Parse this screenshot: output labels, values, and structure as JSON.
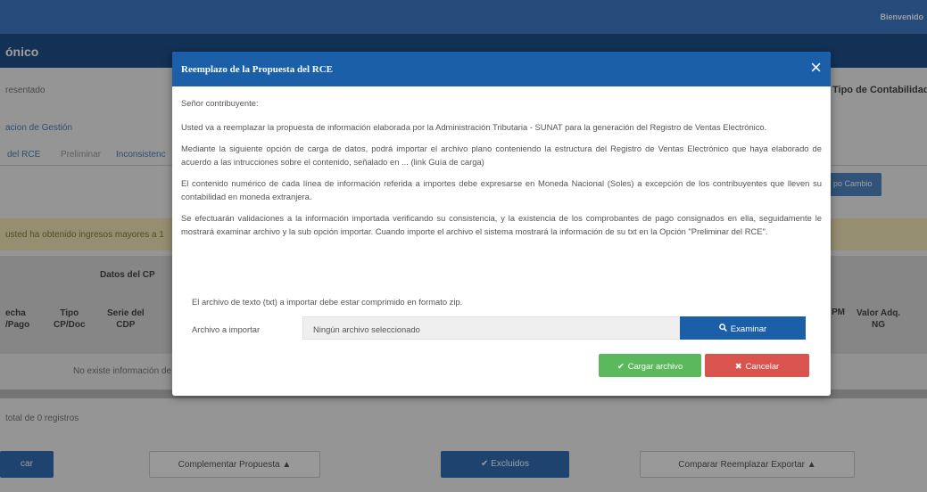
{
  "topbar": {
    "welcome": "Bienvenido"
  },
  "header": {
    "title": "ónico"
  },
  "background": {
    "presentado": "resentado",
    "tipo_contabilidad": "Tipo de Contabilidad:",
    "gestion_link": "acion de Gestión",
    "tabs": [
      "del RCE",
      "Preliminar",
      "Inconsistenc"
    ],
    "tipo_cambio_btn": "po Cambio",
    "alert": "usted ha obtenido ingresos mayores a 1",
    "datos_cp": "Datos del CP",
    "col_fecha": "echa\n/Pago",
    "col_tipo": "Tipo\nCP/Doc",
    "col_serie": "Serie del\nCDP",
    "col_pm": "PM",
    "col_valor": "Valor Adq.\nNG",
    "no_info": "No existe información de C",
    "total": "total de 0 registros",
    "bottom_buttons": {
      "first": "car",
      "complementar": "Complementar Propuesta",
      "excluidos": "Excluidos",
      "comparar": "Comparar Reemplazar Exportar"
    }
  },
  "modal": {
    "title": "Reemplazo de la Propuesta del RCE",
    "close": "×",
    "greeting": "Señor contribuyente:",
    "para1": "Usted va a reemplazar la propuesta de información elaborada por la Administración Tributaria - SUNAT para la generación del Registro de Ventas Electrónico.",
    "para2": "Mediante la siguiente opción de carga de datos, podrá importar el archivo plano conteniendo la estructura del Registro de Ventas Electrónico que haya elaborado de acuerdo a las intrucciones sobre el contenido, señalado en ... (link Guía de carga)",
    "para3": "El contenido numérico de cada línea de información referida a importes debe expresarse en Moneda Nacional (Soles) a excepción de los contribuyentes que lleven su contabilidad en moneda extranjera.",
    "para4": "Se efectuarán validaciones a la información importada verificando su consistencia, y la existencia de los comprobantes de pago consignados en ella, seguidamente le mostrará examinar archivo y la sub opción importar. Cuando importe el archivo el sistema mostrará la información de su txt en la Opción \"Preliminar del RCE\".",
    "zip_note": "El archivo de texto (txt) a importar debe estar comprimido en formato zip.",
    "file_label": "Archivo a importar",
    "file_placeholder": "Ningún archivo seleccionado",
    "examinar": "Examinar",
    "cargar": "Cargar archivo",
    "cancelar": "Cancelar"
  },
  "colors": {
    "modal_header": "#1a5fa8",
    "success": "#5cb85c",
    "danger": "#d9534f"
  }
}
